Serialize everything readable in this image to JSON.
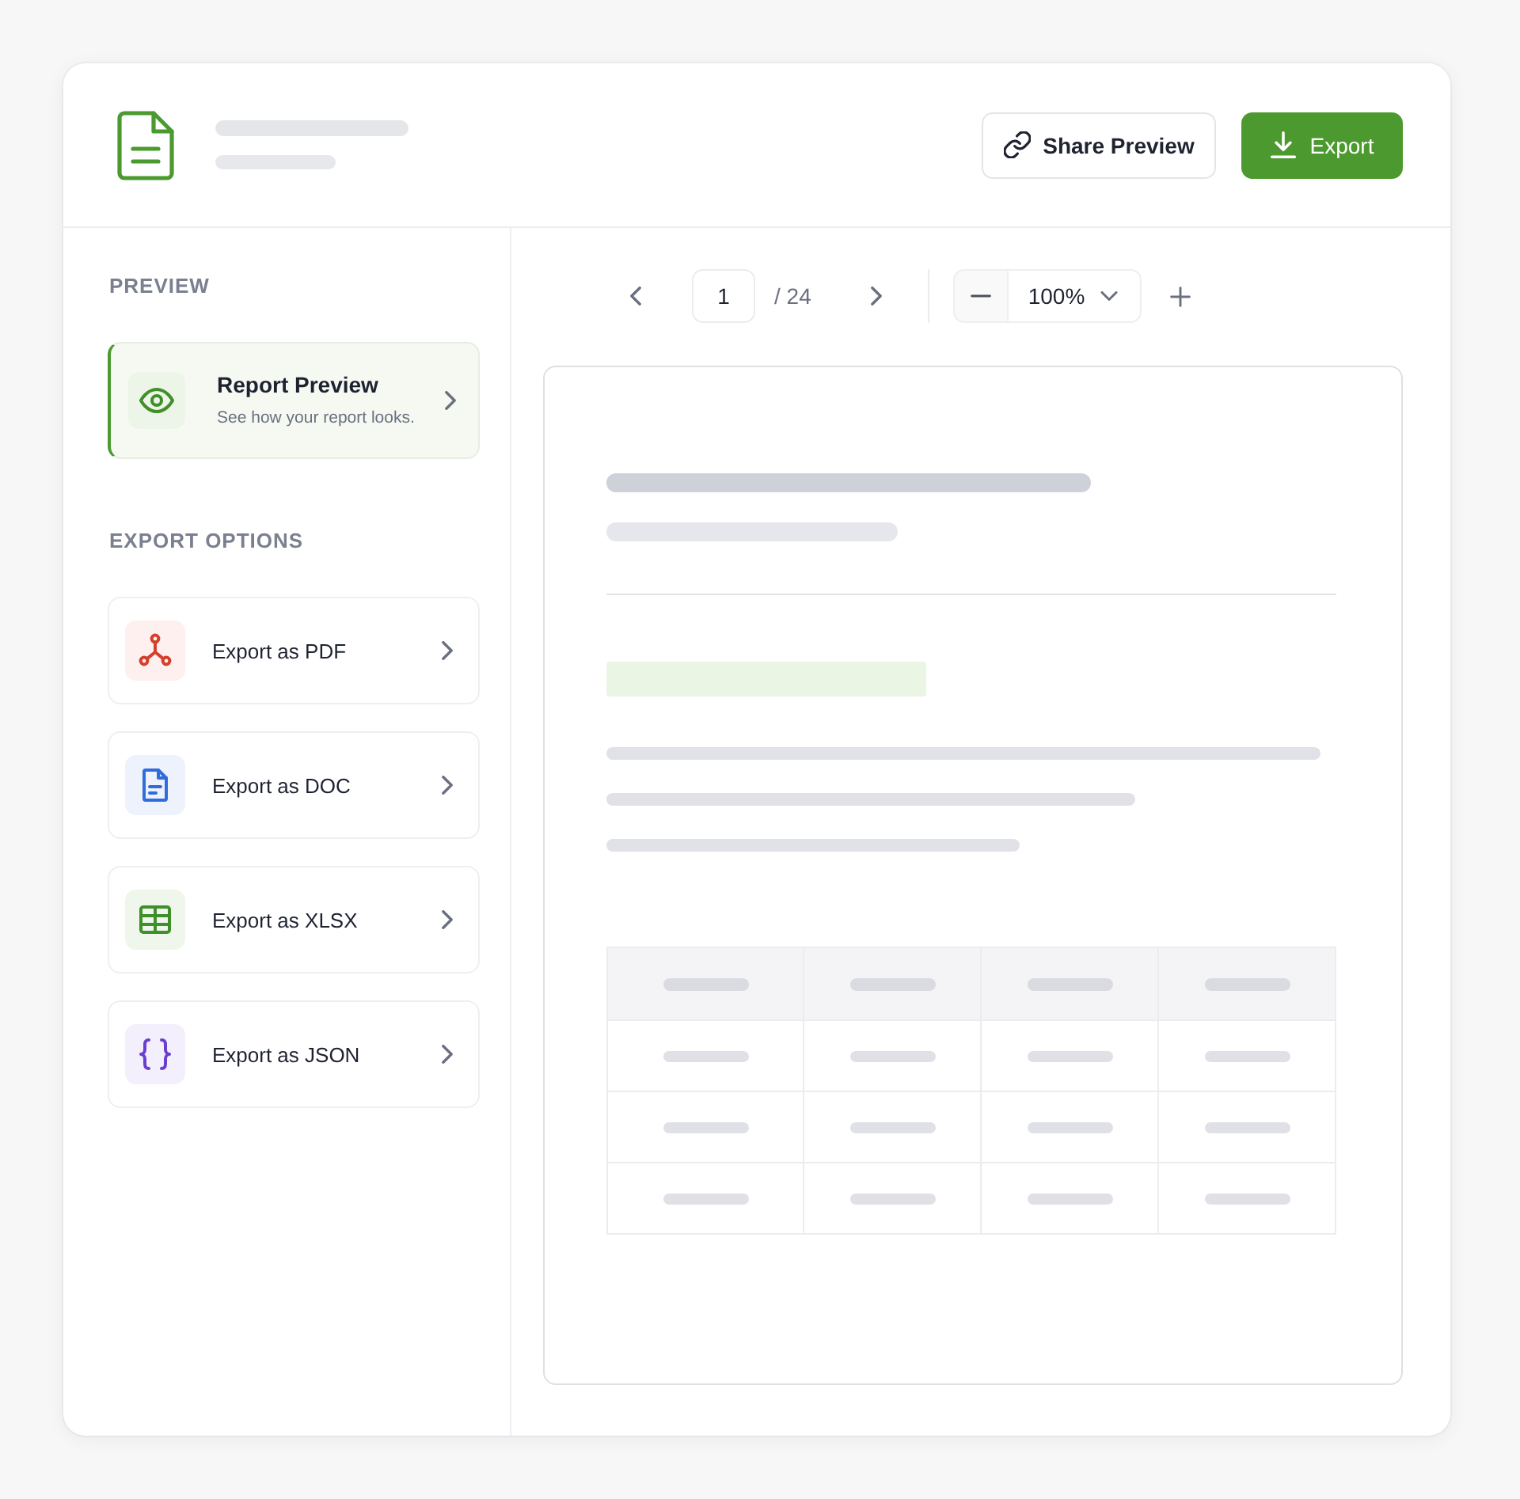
{
  "header": {
    "buttons": [
      {
        "kind": "share",
        "label": "Share Preview"
      },
      {
        "kind": "export",
        "label": "Export"
      }
    ]
  },
  "sidebar": {
    "sections": [
      {
        "title": "PREVIEW",
        "items": [
          {
            "kind": "preview",
            "title": "Report Preview",
            "subtitle": "See how your report looks.",
            "selected": true
          }
        ]
      },
      {
        "title": "EXPORT OPTIONS",
        "items": [
          {
            "kind": "pdf",
            "title": "Export as PDF",
            "selected": false
          },
          {
            "kind": "doc",
            "title": "Export as DOC",
            "selected": false
          },
          {
            "kind": "xlsx",
            "title": "Export as XLSX",
            "selected": false
          },
          {
            "kind": "json",
            "title": "Export as JSON",
            "selected": false
          }
        ]
      }
    ]
  },
  "toolbar": {
    "page_field": {
      "value": "1"
    },
    "page_total": "/ 24",
    "zoom_select": {
      "value": "100%"
    }
  }
}
